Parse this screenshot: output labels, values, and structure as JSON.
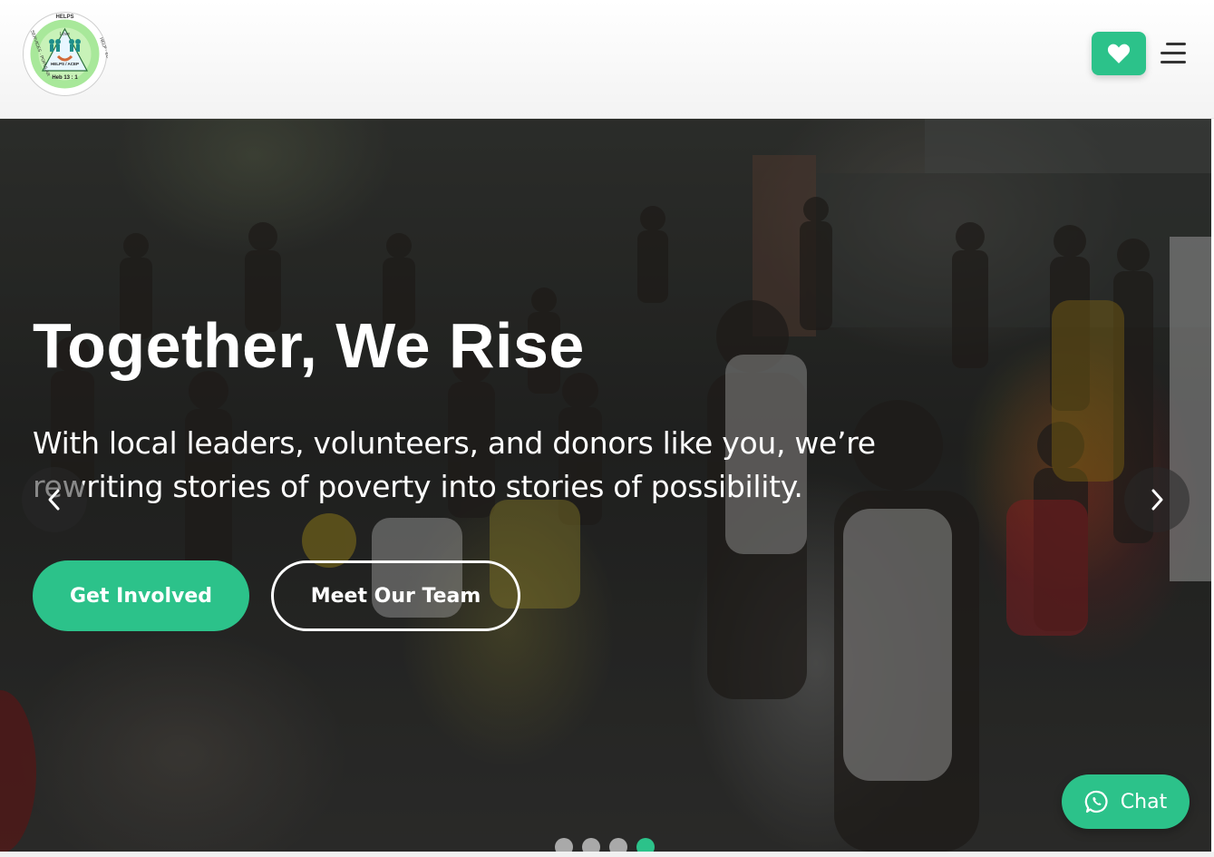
{
  "header": {
    "logo": {
      "ring_text_top": "HELPS",
      "ring_text_right": "HELP · EDUCATION",
      "ring_text_left": "SERVICES · POPULAR",
      "center_word": "Love",
      "center_label": "HELPS / ACEP",
      "verse": "Heb 13 : 1"
    },
    "donate_icon": "heart-icon",
    "menu_icon": "hamburger-menu-icon"
  },
  "hero": {
    "title": "Together, We Rise",
    "subtitle": "With local leaders, volunteers, and donors like you, we’re rewriting stories of poverty into stories of possibility.",
    "primary_button": "Get Involved",
    "secondary_button": "Meet Our Team",
    "slides_total": 4,
    "active_slide": 4
  },
  "chat": {
    "label": "Chat",
    "icon": "whatsapp-icon"
  },
  "colors": {
    "accent": "#2cc28a",
    "overlay": "#2b2c2a",
    "dot_inactive": "#a9a9a9"
  }
}
